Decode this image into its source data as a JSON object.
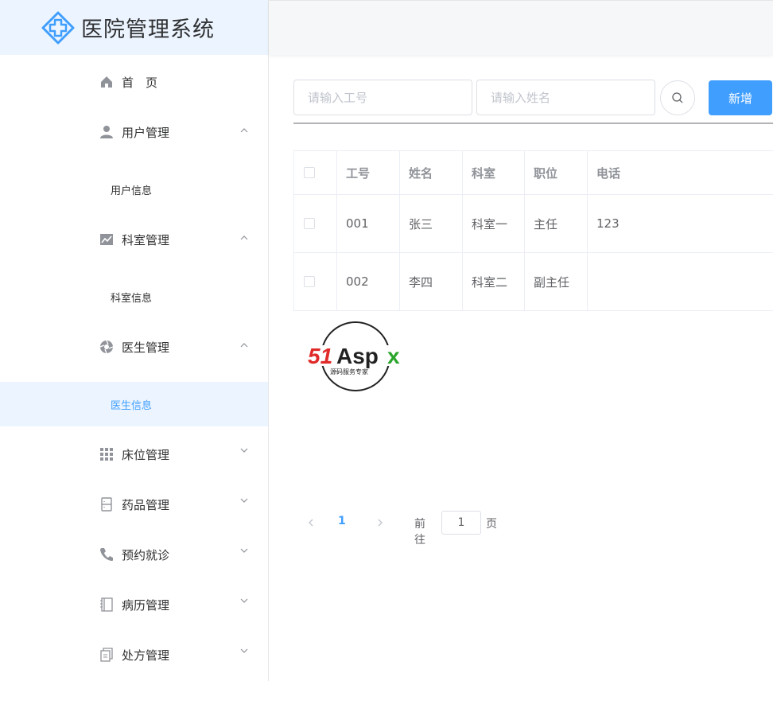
{
  "brand": {
    "title": "医院管理系统"
  },
  "sidebar": {
    "items": [
      {
        "label": "首　页",
        "icon": "home-icon"
      },
      {
        "label": "用户管理",
        "icon": "user-icon",
        "expanded": true,
        "children": [
          {
            "label": "用户信息"
          }
        ]
      },
      {
        "label": "科室管理",
        "icon": "chart-icon",
        "expanded": true,
        "children": [
          {
            "label": "科室信息"
          }
        ]
      },
      {
        "label": "医生管理",
        "icon": "aperture-icon",
        "expanded": true,
        "children": [
          {
            "label": "医生信息",
            "active": true
          }
        ]
      },
      {
        "label": "床位管理",
        "icon": "grid-icon",
        "expanded": false
      },
      {
        "label": "药品管理",
        "icon": "cabinet-icon",
        "expanded": false
      },
      {
        "label": "预约就诊",
        "icon": "phone-icon",
        "expanded": false
      },
      {
        "label": "病历管理",
        "icon": "notebook-icon",
        "expanded": false
      },
      {
        "label": "处方管理",
        "icon": "document-icon",
        "expanded": false
      }
    ]
  },
  "toolbar": {
    "id_placeholder": "请输入工号",
    "name_placeholder": "请输入姓名",
    "add_label": "新增"
  },
  "table": {
    "columns": [
      "工号",
      "姓名",
      "科室",
      "职位",
      "电话"
    ],
    "rows": [
      [
        "001",
        "张三",
        "科室一",
        "主任",
        "123"
      ],
      [
        "002",
        "李四",
        "科室二",
        "副主任",
        ""
      ]
    ]
  },
  "watermark": {
    "text": "51Aspx",
    "subtext": "源码服务专家"
  },
  "pagination": {
    "current_page": "1",
    "goto_label": "前往",
    "goto_value": "1",
    "unit": "页"
  },
  "colors": {
    "primary": "#409eff",
    "active_bg": "#ecf5ff",
    "border": "#dcdfe6"
  }
}
